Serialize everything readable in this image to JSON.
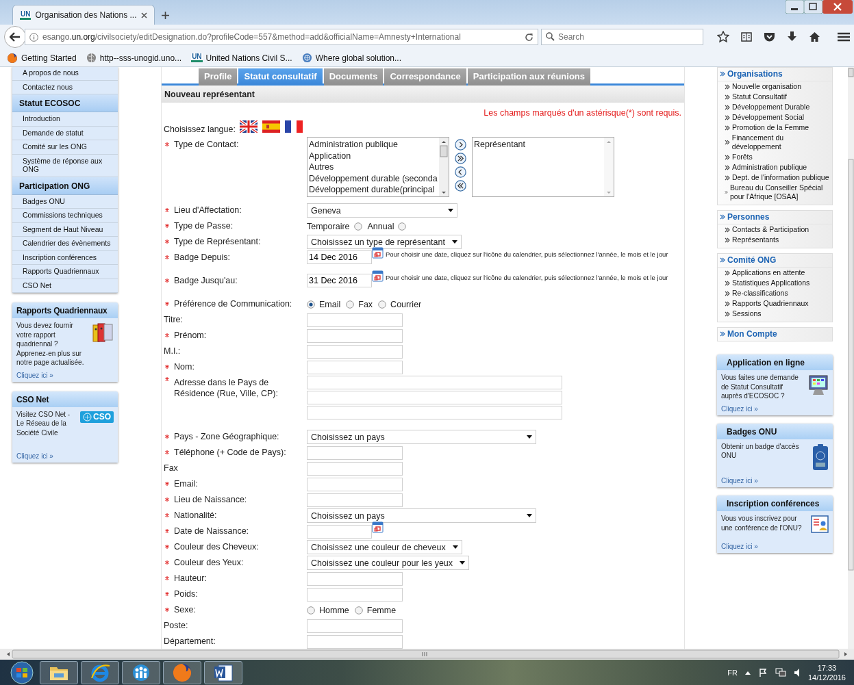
{
  "browser": {
    "tab_logo": "UN",
    "tab_title": "Organisation des Nations ...",
    "url": "esango.**un.org**/civilsociety/editDesignation.do?profileCode=557&method=add&officialName=Amnesty+International",
    "search_placeholder": "Search",
    "bookmarks": [
      {
        "kind": "firefox",
        "label": "Getting Started"
      },
      {
        "kind": "globe",
        "label": "http--sss-unogid.uno..."
      },
      {
        "kind": "un",
        "logo": "UN",
        "label": "United Nations Civil S..."
      },
      {
        "kind": "emblem",
        "label": "Where global solution..."
      }
    ]
  },
  "left_nav": {
    "items": [
      {
        "kind": "link",
        "label": "A propos de nous"
      },
      {
        "kind": "link",
        "label": "Contactez nous"
      },
      {
        "kind": "header",
        "label": "Statut ECOSOC"
      },
      {
        "kind": "link",
        "label": "Introduction"
      },
      {
        "kind": "link",
        "label": "Demande de statut"
      },
      {
        "kind": "link",
        "label": "Comité sur les ONG"
      },
      {
        "kind": "link",
        "label": "Système de réponse aux ONG"
      },
      {
        "kind": "header",
        "label": "Participation ONG"
      },
      {
        "kind": "link",
        "label": "Badges ONU"
      },
      {
        "kind": "link",
        "label": "Commissions techniques"
      },
      {
        "kind": "link",
        "label": "Segment de Haut Niveau"
      },
      {
        "kind": "link",
        "label": "Calendrier des évènements"
      },
      {
        "kind": "link",
        "label": "Inscription conférences"
      },
      {
        "kind": "link",
        "label": "Rapports Quadriennaux"
      },
      {
        "kind": "link",
        "label": "CSO Net"
      }
    ],
    "boxes": [
      {
        "kind": "binders",
        "title": "Rapports Quadriennaux",
        "text": "Vous devez fournir votre rapport quadriennal ? Apprenez-en plus sur notre page actualisée.",
        "link": "Cliquez ici »"
      },
      {
        "kind": "cso",
        "badge": "CSO",
        "title": "CSO Net",
        "text": "Visitez CSO Net - Le Réseau de la Société Civile",
        "link": "Cliquez ici »"
      }
    ]
  },
  "main": {
    "tabs": [
      {
        "label": "Profile",
        "selected": false
      },
      {
        "label": "Statut consultatif",
        "selected": true
      },
      {
        "label": "Documents",
        "selected": false
      },
      {
        "label": "Correspondance",
        "selected": false
      },
      {
        "label": "Participation aux réunions",
        "selected": false
      }
    ],
    "section_title": "Nouveau représentant",
    "required_note": "Les champs marqués d'un astérisque(*) sont requis.",
    "language_label": "Choisissez langue:",
    "flags": [
      {
        "kind": "uk"
      },
      {
        "kind": "es"
      },
      {
        "kind": "fr"
      }
    ],
    "fields": [
      {
        "kind": "transfer",
        "label": "Type de Contact:",
        "required": true,
        "available": [
          "Administration publique",
          "Application",
          "Autres",
          "Développement durable (seconda",
          "Développement durable(principal"
        ],
        "chosen": [
          "Représentant"
        ]
      },
      {
        "kind": "select",
        "label": "Lieu d'Affectation:",
        "required": true,
        "value": "Geneva"
      },
      {
        "kind": "radio-after",
        "label": "Type de Passe:",
        "required": true,
        "options": [
          {
            "label": "Temporaire",
            "selected": false
          },
          {
            "label": "Annual",
            "selected": false
          }
        ]
      },
      {
        "kind": "select",
        "label": "Type de Représentant:",
        "required": true,
        "value": "Choisissez un type de représentant"
      },
      {
        "kind": "date",
        "label": "Badge Depuis:",
        "required": true,
        "value": "14 Dec 2016",
        "hint": "Pour choisir une date, cliquez sur l'icône du calendrier, puis sélectionnez l'année, le mois et le jour"
      },
      {
        "kind": "date",
        "label": "Badge Jusqu'au:",
        "required": true,
        "value": "31 Dec 2016",
        "hint": "Pour choisir une date, cliquez sur l'icône du calendrier, puis sélectionnez l'année, le mois et le jour"
      },
      {
        "kind": "radio",
        "label": "Préférence de Communication:",
        "required": true,
        "options": [
          {
            "label": "Email",
            "selected": true
          },
          {
            "label": "Fax",
            "selected": false
          },
          {
            "label": "Courrier",
            "selected": false
          }
        ]
      },
      {
        "kind": "text",
        "label": "Titre:",
        "required": false
      },
      {
        "kind": "text",
        "label": "Prénom:",
        "required": true
      },
      {
        "kind": "text",
        "label": "M.I.:",
        "required": false
      },
      {
        "kind": "text",
        "label": "Nom:",
        "required": true
      },
      {
        "kind": "address",
        "label": "Adresse dans le Pays de Résidence (Rue, Ville, CP):",
        "required": true
      },
      {
        "kind": "select",
        "label": "Pays - Zone Géographique:",
        "required": true,
        "value": "Choisissez un pays",
        "wide": true
      },
      {
        "kind": "text",
        "label": "Téléphone (+ Code de Pays):",
        "required": true
      },
      {
        "kind": "text",
        "label": "Fax",
        "required": false
      },
      {
        "kind": "text",
        "label": "Email:",
        "required": true
      },
      {
        "kind": "text",
        "label": "Lieu de Naissance:",
        "required": true
      },
      {
        "kind": "select",
        "label": "Nationalité:",
        "required": true,
        "value": "Choisissez un pays",
        "wide": true
      },
      {
        "kind": "date",
        "label": "Date de Naissance:",
        "required": true
      },
      {
        "kind": "select",
        "label": "Couleur des Cheveux:",
        "required": true,
        "value": "Choisissez une couleur de cheveux"
      },
      {
        "kind": "select",
        "label": "Couleur des Yeux:",
        "required": true,
        "value": "Choisissez une couleur pour les yeux"
      },
      {
        "kind": "text",
        "label": "Hauteur:",
        "required": true
      },
      {
        "kind": "text",
        "label": "Poids:",
        "required": true
      },
      {
        "kind": "radio",
        "label": "Sexe:",
        "required": true,
        "options": [
          {
            "label": "Homme",
            "selected": false
          },
          {
            "label": "Femme",
            "selected": false
          }
        ]
      },
      {
        "kind": "text",
        "label": "Poste:",
        "required": false
      },
      {
        "kind": "text",
        "label": "Département:",
        "required": false
      }
    ]
  },
  "right_nav": {
    "sections": [
      {
        "title": "Organisations",
        "items": [
          "Nouvelle organisation",
          "Statut Consultatif",
          "Développement Durable",
          "Développement Social",
          "Promotion de la Femme",
          "Financement du développement",
          "Forêts",
          "Administration publique",
          "Dept. de l'information publique",
          "Bureau du Conseiller Spécial pour l'Afrique [OSAA]"
        ]
      },
      {
        "title": "Personnes",
        "items": [
          "Contacts & Participation",
          "Représentants"
        ]
      },
      {
        "title": "Comité ONG",
        "items": [
          "Applications en attente",
          "Statistiques Applications",
          "Re-classifications",
          "Rapports Quadriennaux",
          "Sessions"
        ]
      },
      {
        "title": "Mon Compte"
      }
    ],
    "boxes": [
      {
        "kind": "monitor",
        "title": "Application en ligne",
        "text": "Vous faites une demande de Statut Consultatif auprès d'ECOSOC ?",
        "link": "Cliquez ici »"
      },
      {
        "kind": "badge",
        "title": "Badges ONU",
        "text": "Obtenir un badge d'accès ONU",
        "link": "Cliquez ici »"
      },
      {
        "kind": "form",
        "title": "Inscription conférences",
        "text": "Vous vous inscrivez pour une conférence de l'ONU?",
        "link": "Cliquez ici »"
      }
    ]
  },
  "taskbar": {
    "apps": [
      {
        "kind": "explorer"
      },
      {
        "kind": "ie"
      },
      {
        "kind": "people"
      },
      {
        "kind": "firefox"
      },
      {
        "kind": "word"
      }
    ],
    "language": "FR",
    "time": "17:33",
    "date": "14/12/2016"
  }
}
